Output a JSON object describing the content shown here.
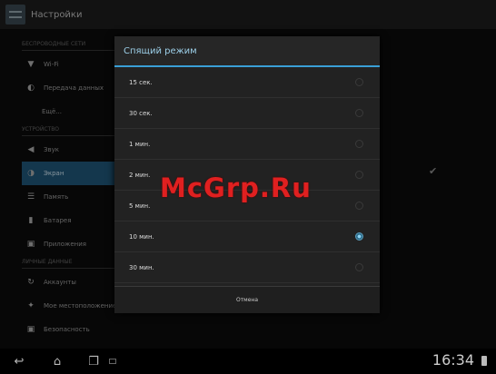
{
  "topbar": {
    "title": "Настройки"
  },
  "sidebar": {
    "sections": [
      {
        "header": "БЕСПРОВОДНЫЕ СЕТИ",
        "items": [
          {
            "label": "Wi-Fi",
            "icon": "wifi-icon",
            "indent": false
          },
          {
            "label": "Передача данных",
            "icon": "data-usage-icon",
            "indent": false
          },
          {
            "label": "Ещё...",
            "icon": "",
            "indent": true
          }
        ]
      },
      {
        "header": "УСТРОЙСТВО",
        "items": [
          {
            "label": "Звук",
            "icon": "sound-icon",
            "indent": false
          },
          {
            "label": "Экран",
            "icon": "display-icon",
            "indent": false,
            "active": true
          },
          {
            "label": "Память",
            "icon": "storage-icon",
            "indent": false
          },
          {
            "label": "Батарея",
            "icon": "battery-icon",
            "indent": false
          },
          {
            "label": "Приложения",
            "icon": "apps-icon",
            "indent": false
          }
        ]
      },
      {
        "header": "ЛИЧНЫЕ ДАННЫЕ",
        "items": [
          {
            "label": "Аккаунты",
            "icon": "sync-icon",
            "indent": false
          },
          {
            "label": "Мое местоположение",
            "icon": "location-icon",
            "indent": false
          },
          {
            "label": "Безопасность",
            "icon": "lock-icon",
            "indent": false
          }
        ]
      }
    ]
  },
  "dialog": {
    "title": "Спящий режим",
    "options": [
      {
        "label": "15 сек.",
        "selected": false
      },
      {
        "label": "30 сек.",
        "selected": false
      },
      {
        "label": "1 мин.",
        "selected": false
      },
      {
        "label": "2 мин.",
        "selected": false
      },
      {
        "label": "5 мин.",
        "selected": false
      },
      {
        "label": "10 мин.",
        "selected": true
      },
      {
        "label": "30 мин.",
        "selected": false
      }
    ],
    "cancel_label": "Отмена"
  },
  "watermark": "McGrp.Ru",
  "statusbar": {
    "time": "16:34"
  },
  "colors": {
    "accent": "#3a9fd6",
    "active_item": "#1f5577",
    "watermark": "#e02020"
  }
}
